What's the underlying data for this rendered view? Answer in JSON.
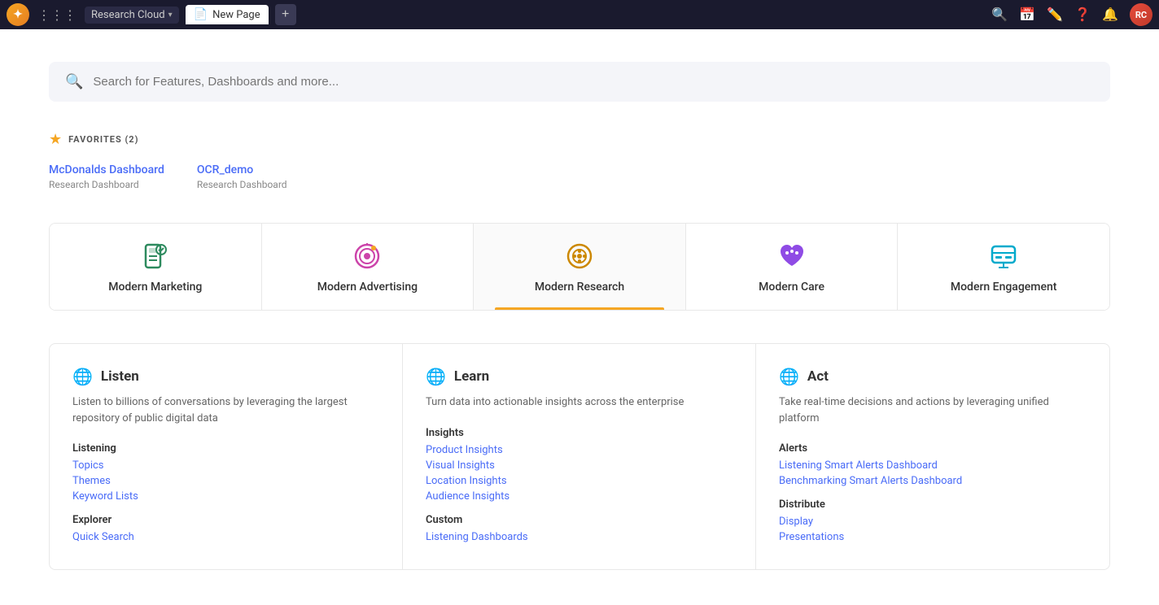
{
  "topnav": {
    "logo_symbol": "✦",
    "workspace_label": "Research Cloud",
    "workspace_chevron": "▾",
    "page_tab_label": "New Page",
    "add_tab_label": "+",
    "icons": {
      "search": "⌕",
      "calendar": "⊟",
      "edit": "✎",
      "help": "?",
      "bell": "🔔"
    },
    "avatar_initials": "RC"
  },
  "search": {
    "placeholder": "Search for Features, Dashboards and more..."
  },
  "favorites": {
    "title": "FAVORITES (2)",
    "items": [
      {
        "name": "McDonalds Dashboard",
        "type": "Research Dashboard"
      },
      {
        "name": "OCR_demo",
        "type": "Research Dashboard"
      }
    ]
  },
  "module_tabs": [
    {
      "id": "marketing",
      "label": "Modern Marketing",
      "active": false
    },
    {
      "id": "advertising",
      "label": "Modern Advertising",
      "active": false
    },
    {
      "id": "research",
      "label": "Modern Research",
      "active": true
    },
    {
      "id": "care",
      "label": "Modern Care",
      "active": false
    },
    {
      "id": "engagement",
      "label": "Modern Engagement",
      "active": false
    }
  ],
  "feature_panels": [
    {
      "id": "listen",
      "title": "Listen",
      "description": "Listen to billions of conversations by leveraging the largest repository of public digital data",
      "sections": [
        {
          "label": "Listening",
          "links": [
            {
              "text": "Topics",
              "href": "#"
            },
            {
              "text": "Themes",
              "href": "#"
            },
            {
              "text": "Keyword Lists",
              "href": "#"
            }
          ]
        },
        {
          "label": "Explorer",
          "links": [
            {
              "text": "Quick Search",
              "href": "#"
            }
          ]
        }
      ]
    },
    {
      "id": "learn",
      "title": "Learn",
      "description": "Turn data into actionable insights across the enterprise",
      "sections": [
        {
          "label": "Insights",
          "links": [
            {
              "text": "Product Insights",
              "href": "#"
            },
            {
              "text": "Visual Insights",
              "href": "#"
            },
            {
              "text": "Location Insights",
              "href": "#"
            },
            {
              "text": "Audience Insights",
              "href": "#"
            }
          ]
        },
        {
          "label": "Custom",
          "links": [
            {
              "text": "Listening Dashboards",
              "href": "#"
            }
          ]
        }
      ]
    },
    {
      "id": "act",
      "title": "Act",
      "description": "Take real-time decisions and actions by leveraging unified platform",
      "sections": [
        {
          "label": "Alerts",
          "links": [
            {
              "text": "Listening Smart Alerts Dashboard",
              "href": "#"
            },
            {
              "text": "Benchmarking Smart Alerts Dashboard",
              "href": "#"
            }
          ]
        },
        {
          "label": "Distribute",
          "links": [
            {
              "text": "Display",
              "href": "#"
            },
            {
              "text": "Presentations",
              "href": "#"
            }
          ]
        }
      ]
    }
  ],
  "colors": {
    "accent_blue": "#4a6cf7",
    "accent_gold": "#f5a623",
    "nav_bg": "#1a1a2e"
  }
}
